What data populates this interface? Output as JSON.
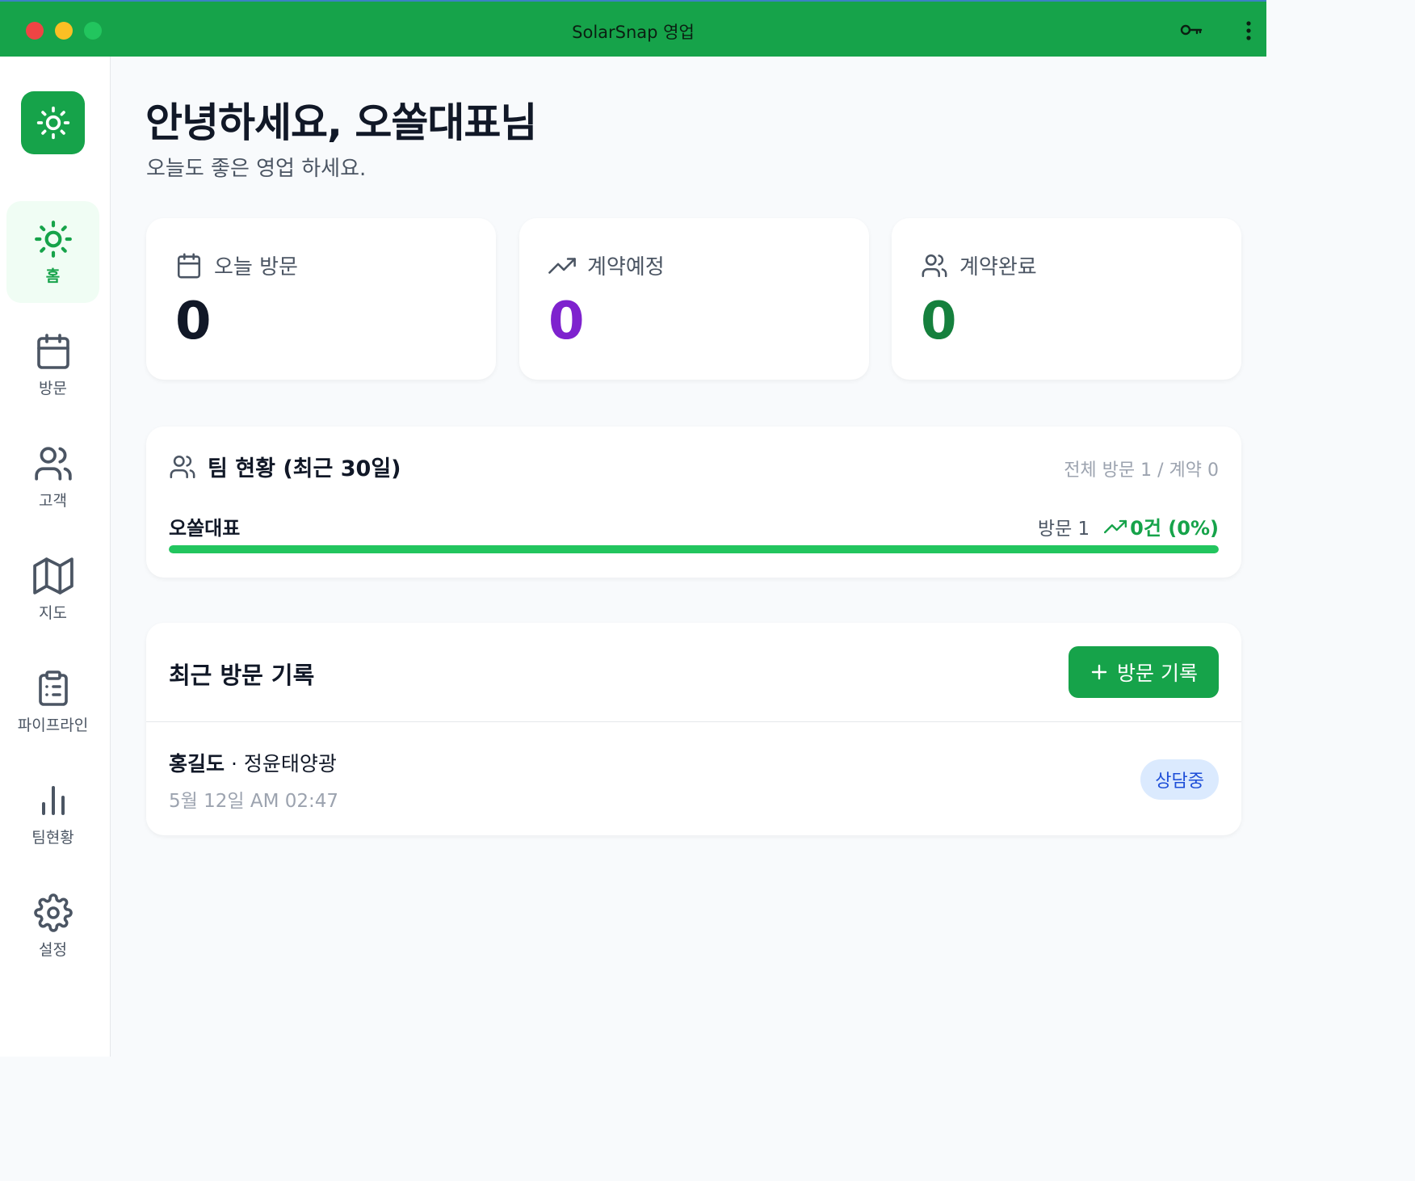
{
  "window": {
    "title": "SolarSnap 영업"
  },
  "sidebar": {
    "items": [
      {
        "label": "홈",
        "icon": "sun-icon",
        "active": true
      },
      {
        "label": "방문",
        "icon": "calendar-icon",
        "active": false
      },
      {
        "label": "고객",
        "icon": "users-icon",
        "active": false
      },
      {
        "label": "지도",
        "icon": "map-icon",
        "active": false
      },
      {
        "label": "파이프라인",
        "icon": "clipboard-list-icon",
        "active": false
      },
      {
        "label": "팀현황",
        "icon": "bar-chart-icon",
        "active": false
      },
      {
        "label": "설정",
        "icon": "gear-icon",
        "active": false
      }
    ]
  },
  "greeting": {
    "title": "안녕하세요, 오쏠대표님",
    "subtitle": "오늘도 좋은 영업 하세요."
  },
  "stats": [
    {
      "label": "오늘 방문",
      "value": "0",
      "icon": "calendar-icon",
      "color": "#111827"
    },
    {
      "label": "계약예정",
      "value": "0",
      "icon": "trending-up-icon",
      "color": "#7e22ce"
    },
    {
      "label": "계약완료",
      "value": "0",
      "icon": "users-icon",
      "color": "#15803d"
    }
  ],
  "team": {
    "title": "팀 현황 (최근 30일)",
    "summary": "전체 방문 1 / 계약 0",
    "members": [
      {
        "name": "오쏠대표",
        "visits": "방문 1",
        "contracts": "0건 (0%)",
        "progress": 1.0
      }
    ]
  },
  "recent_visits": {
    "title": "최근 방문 기록",
    "add_button": "방문 기록",
    "items": [
      {
        "customer": "홍길도",
        "separator": " · ",
        "company": "정윤태양광",
        "datetime": "5월 12일 AM 02:47",
        "status": "상담중"
      }
    ]
  },
  "colors": {
    "brand": "#16a34a",
    "progress": "#22c55e",
    "badge_bg": "#dbeafe",
    "badge_text": "#1d4ed8"
  }
}
